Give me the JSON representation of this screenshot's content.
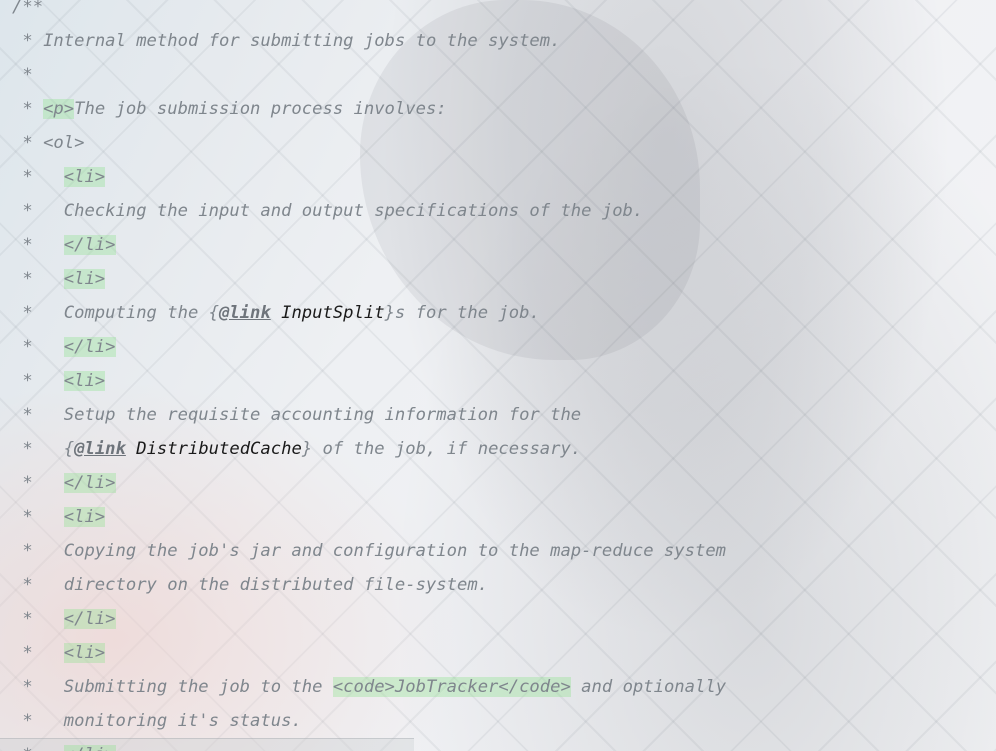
{
  "javadoc": {
    "open": "/**",
    "star": "*",
    "summary": "Internal method for submitting jobs to the system.",
    "p_tag": "<p>",
    "intro": "The job submission process involves:",
    "ol_tag": "<ol>",
    "li_open": "<li>",
    "li_close": "</li>",
    "step1": "Checking the input and output specifications of the job.",
    "step2_pre": "Computing the {",
    "step2_link": "@link",
    "step2_ref": "InputSplit",
    "step2_post": "}s for the job.",
    "step3_line1": "Setup the requisite accounting information for the",
    "step3_pre": "{",
    "step3_link": "@link",
    "step3_ref": "DistributedCache",
    "step3_post": "} of the job, if necessary.",
    "step4_line1": "Copying the job's jar and configuration to the map-reduce system",
    "step4_line2": "directory on the distributed file-system.",
    "step5_pre": "Submitting the job to the ",
    "code_open": "<code>",
    "step5_code": "JobTracker",
    "code_close": "</code>",
    "step5_post": " and optionally",
    "step5_line2": "monitoring it's status."
  }
}
